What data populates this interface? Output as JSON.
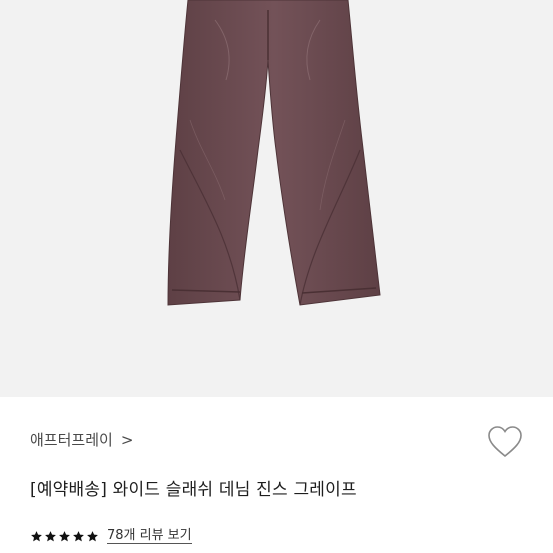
{
  "product": {
    "image_icon": "wide-slash-denim-pants-photo",
    "brand": "애프터프레이",
    "brand_chevron": ">",
    "title": "[예약배송] 와이드 슬래쉬 데님 진스 그레이프",
    "wishlist_icon": "heart-outline-icon",
    "rating_stars": 5,
    "review_link": "78개 리뷰 보기"
  },
  "colors": {
    "image_background": "#f2f2f2",
    "denim": "#6a4a4f",
    "star": "#111111",
    "heart_stroke": "#8a8a8a"
  }
}
